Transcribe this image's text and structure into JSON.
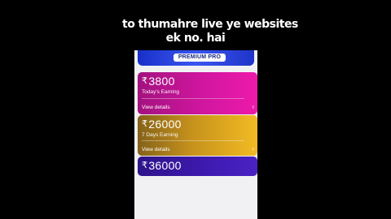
{
  "overlay_caption": {
    "line1": "to thumahre live ye websites",
    "line2": "ek no. hai"
  },
  "banner": {
    "badge_label": "PREMIUM PRO"
  },
  "cards": [
    {
      "currency": "₹",
      "amount": "3800",
      "label": "Today's Earning",
      "link": "View details",
      "color_start": "#a3127f",
      "color_end": "#ed1aaa"
    },
    {
      "currency": "₹",
      "amount": "26000",
      "label": "7 Days Earning",
      "link": "View details",
      "color_start": "#85621a",
      "color_end": "#f2bb24"
    },
    {
      "currency": "₹",
      "amount": "36000",
      "color_start": "#2d148a",
      "color_end": "#4a22c2"
    }
  ],
  "icons": {
    "chevron": "chevron-right-icon"
  }
}
